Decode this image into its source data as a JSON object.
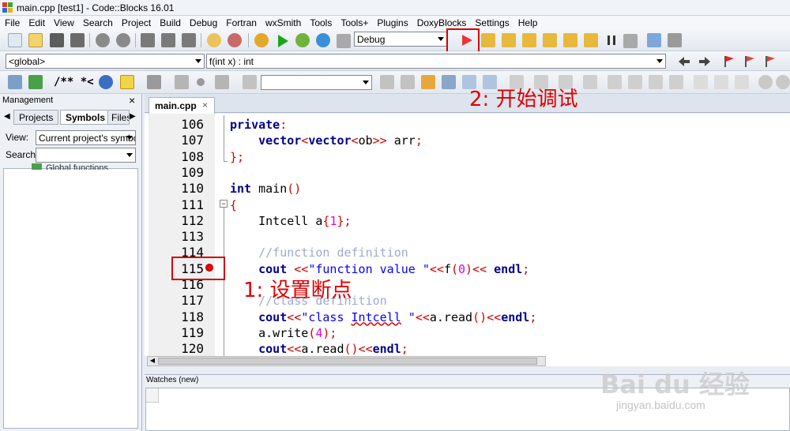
{
  "window": {
    "title": "main.cpp [test1] - Code::Blocks 16.01"
  },
  "menu": [
    "File",
    "Edit",
    "View",
    "Search",
    "Project",
    "Build",
    "Debug",
    "Fortran",
    "wxSmith",
    "Tools",
    "Tools+",
    "Plugins",
    "DoxyBlocks",
    "Settings",
    "Help"
  ],
  "toolbar": {
    "build_target": "Debug",
    "scope": "<global>",
    "function": "f(int x) : int",
    "doxy_comment": "/** *<"
  },
  "management": {
    "title": "Management",
    "tabs": [
      "Projects",
      "Symbols",
      "Files"
    ],
    "view_label": "View:",
    "view_value": "Current project's symbols",
    "search_label": "Search:",
    "tree_item": "Global functions"
  },
  "editor": {
    "file_tab": "main.cpp",
    "lines": [
      {
        "n": "106",
        "html": "<span class=\"kw\">private</span><span class=\"op\">:</span>"
      },
      {
        "n": "107",
        "html": "    <span class=\"kw\">vector</span><span class=\"op\">&lt;</span><span class=\"kw\">vector</span><span class=\"op\">&lt;</span>ob<span class=\"op\">&gt;&gt;</span> arr<span class=\"op\">;</span>"
      },
      {
        "n": "108",
        "html": "<span class=\"op\">};</span>"
      },
      {
        "n": "109",
        "html": ""
      },
      {
        "n": "110",
        "html": "<span class=\"kw\">int</span> main<span class=\"op\">()</span>"
      },
      {
        "n": "111",
        "html": "<span class=\"op\">{</span>"
      },
      {
        "n": "112",
        "html": "    Intcell a<span class=\"op\">{</span><span class=\"num\">1</span><span class=\"op\">};</span>"
      },
      {
        "n": "113",
        "html": ""
      },
      {
        "n": "114",
        "html": "    <span class=\"cm\">//function definition</span>"
      },
      {
        "n": "115",
        "html": "    <span class=\"kw\">cout</span> <span class=\"op\">&lt;&lt;</span><span class=\"str\">\"function value \"</span><span class=\"op\">&lt;&lt;</span>f<span class=\"op\">(</span><span class=\"num\">0</span><span class=\"op\">)&lt;&lt;</span> <span class=\"kw\">endl</span><span class=\"op\">;</span>"
      },
      {
        "n": "116",
        "html": ""
      },
      {
        "n": "117",
        "html": "    <span class=\"cm\">//class definition</span>"
      },
      {
        "n": "118",
        "html": "    <span class=\"kw\">cout</span><span class=\"op\">&lt;&lt;</span><span class=\"str\">\"class <u style=\"text-decoration:underline wavy #d40000\">Intcell</u> \"</span><span class=\"op\">&lt;&lt;</span>a.read<span class=\"op\">()&lt;&lt;</span><span class=\"kw\">endl</span><span class=\"op\">;</span>"
      },
      {
        "n": "119",
        "html": "    a.write<span class=\"op\">(</span><span class=\"num\">4</span><span class=\"op\">);</span>"
      },
      {
        "n": "120",
        "html": "    <span class=\"kw\">cout</span><span class=\"op\">&lt;&lt;</span>a.read<span class=\"op\">()&lt;&lt;</span><span class=\"kw\">endl</span><span class=\"op\">;</span>"
      }
    ]
  },
  "watches": {
    "title": "Watches (new)"
  },
  "annotations": {
    "step1": "1:  设置断点",
    "step2": "2:  开始调试"
  },
  "watermark": {
    "text": "Bai du 经验",
    "sub": "jingyan.baidu.com"
  },
  "colors": {
    "keyword": "#00008b",
    "operator": "#d40000",
    "string": "#0000ff",
    "comment": "#a0a8d0",
    "annotation": "#e00000"
  }
}
